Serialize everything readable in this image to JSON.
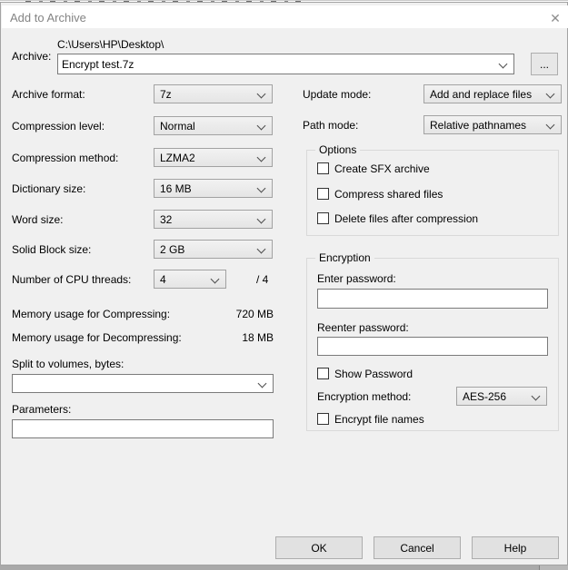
{
  "window": {
    "title": "Add to Archive",
    "close_glyph": "✕"
  },
  "archive": {
    "label": "Archive:",
    "dir_path": "C:\\Users\\HP\\Desktop\\",
    "name": "Encrypt test.7z",
    "browse": "..."
  },
  "left_fields": [
    {
      "label": "Archive format:",
      "value": "7z"
    },
    {
      "label": "Compression level:",
      "value": "Normal"
    },
    {
      "label": "Compression method:",
      "value": "LZMA2"
    },
    {
      "label": "Dictionary size:",
      "value": "16 MB"
    },
    {
      "label": "Word size:",
      "value": "32"
    },
    {
      "label": "Solid Block size:",
      "value": "2 GB"
    }
  ],
  "cpu_threads": {
    "label": "Number of CPU threads:",
    "value": "4",
    "total": "/ 4"
  },
  "memory": {
    "compress_label": "Memory usage for Compressing:",
    "compress_value": "720 MB",
    "decompress_label": "Memory usage for Decompressing:",
    "decompress_value": "18 MB"
  },
  "split": {
    "label": "Split to volumes, bytes:",
    "value": ""
  },
  "parameters": {
    "label": "Parameters:",
    "value": ""
  },
  "update_mode": {
    "label": "Update mode:",
    "value": "Add and replace files"
  },
  "path_mode": {
    "label": "Path mode:",
    "value": "Relative pathnames"
  },
  "options": {
    "title": "Options",
    "items": [
      "Create SFX archive",
      "Compress shared files",
      "Delete files after compression"
    ]
  },
  "encryption": {
    "title": "Encryption",
    "enter_label": "Enter password:",
    "enter_value": "",
    "reenter_label": "Reenter password:",
    "reenter_value": "",
    "show_password": "Show Password",
    "method_label": "Encryption method:",
    "method_value": "AES-256",
    "encrypt_names": "Encrypt file names"
  },
  "buttons": {
    "ok": "OK",
    "cancel": "Cancel",
    "help": "Help"
  },
  "colors": {
    "dialog_bg": "#f0f0f0",
    "titlebar_bg": "#ffffff",
    "title_text": "#848484",
    "input_border": "#7a7a7a",
    "combo_border": "#a2a2a2",
    "button_face": "#e1e1e1"
  }
}
